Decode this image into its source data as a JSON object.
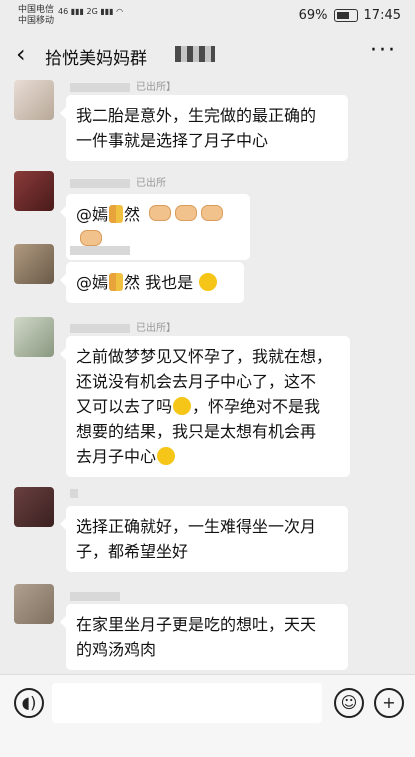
{
  "status": {
    "carrier1": "中国电信",
    "carrier2": "中国移动",
    "sig1": "46",
    "sig2": "2G",
    "battery": "69%",
    "time": "17:45"
  },
  "header": {
    "back_icon": "chevron-left-icon",
    "title": "拾悦美妈妈群",
    "more_icon": "more-horizontal-icon"
  },
  "messages": [
    {
      "name_suffix": "已出所】",
      "lines": [
        "我二胎是意外，生完做的最正确的",
        "一件事就是选择了月子中心"
      ],
      "avatar_color": "#d9ccc4"
    },
    {
      "name_suffix": "已出所",
      "text_prefix": "@嫣",
      "text_suffix": "然",
      "avatar_color": "#7a3030"
    },
    {
      "name_suffix": "",
      "text_prefix": "@嫣",
      "text_suffix": "然  我也是",
      "avatar_color": "#a08870"
    },
    {
      "name_suffix": "已出所】",
      "lines": [
        "之前做梦梦见又怀孕了，我就在想，",
        "还说没有机会去月子中心了，这不",
        "又可以去了吗",
        "，怀孕绝对不是我",
        "想要的结果，我只是太想有机会再",
        "去月子中心"
      ],
      "avatar_color": "#c8d0c0"
    },
    {
      "name_suffix": "",
      "lines": [
        "选择正确就好，一生难得坐一次月",
        "子，都希望坐好"
      ],
      "avatar_color": "#5a3535"
    },
    {
      "name_suffix": "",
      "lines": [
        "在家里坐月子更是吃的想吐，天天",
        "的鸡汤鸡肉"
      ],
      "avatar_color": "#a09080"
    }
  ],
  "input": {
    "voice_icon": "voice-icon",
    "emoji_icon": "emoji-icon",
    "add_icon": "plus-icon"
  }
}
